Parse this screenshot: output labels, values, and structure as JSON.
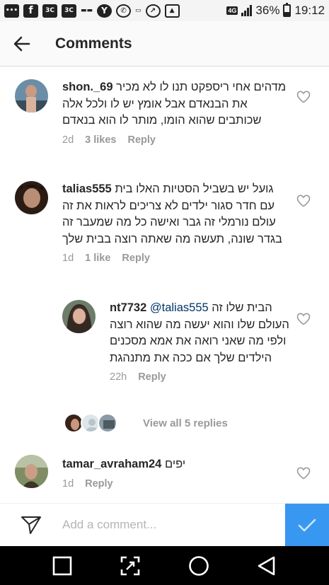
{
  "status_bar": {
    "network": "4G",
    "battery": "36%",
    "time": "19:12",
    "left_icons": [
      "messages-icon",
      "facebook-icon",
      "app-3c-icon",
      "app-3c-icon",
      "news-app-icon",
      "yahoo-icon",
      "whatsapp-icon",
      "app-text-icon",
      "phone-call-icon",
      "gallery-icon"
    ]
  },
  "header": {
    "title": "Comments"
  },
  "comments": [
    {
      "username": "shon._69",
      "text": "מדהים אחי ריספקט תנו לו לא מכיר את הבנאדם אבל אומץ יש לו ולכל אלה שכותבים שהוא הומו, מותר לו הוא בנאדם",
      "time": "2d",
      "likes": "3 likes",
      "reply": "Reply"
    },
    {
      "username": "talias555",
      "text": "גועל יש בשביל הסטיות האלו בית עם חדר סגור ילדים לא צריכים לראות את זה עולם נורמלי זה גבר ואישה כל מה שמעבר זה בגדר שונה, תעשה מה שאתה רוצה בבית שלך",
      "time": "1d",
      "likes": "1 like",
      "reply": "Reply"
    },
    {
      "username": "nt7732",
      "mention": "@talias555",
      "text": "הבית שלו זה העולם שלו והוא יעשה מה שהוא רוצה ולפי מה שאני רואה את אמא מסכנים הילדים שלך אם ככה את מתנהגת",
      "time": "22h",
      "reply": "Reply"
    },
    {
      "username": "tamar_avraham24",
      "text": "יפים",
      "time": "1d",
      "reply": "Reply"
    }
  ],
  "view_replies": "View all 5 replies",
  "composer": {
    "placeholder": "Add a comment..."
  },
  "colors": {
    "accent": "#3897f0",
    "mention": "#003569",
    "meta": "#999999"
  }
}
